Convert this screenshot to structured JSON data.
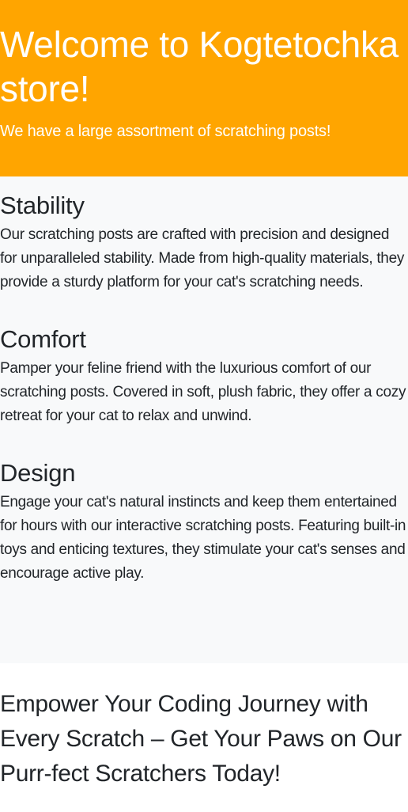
{
  "hero": {
    "title": "Welcome to Kogtetochka store!",
    "subtitle": "We have a large assortment of scratching posts!"
  },
  "features": [
    {
      "title": "Stability",
      "text": "Our scratching posts are crafted with precision and designed for unparalleled stability. Made from high-quality materials, they provide a sturdy platform for your cat's scratching needs."
    },
    {
      "title": "Comfort",
      "text": "Pamper your feline friend with the luxurious comfort of our scratching posts. Covered in soft, plush fabric, they offer a cozy retreat for your cat to relax and unwind."
    },
    {
      "title": "Design",
      "text": "Engage your cat's natural instincts and keep them entertained for hours with our interactive scratching posts. Featuring built-in toys and enticing textures, they stimulate your cat's senses and encourage active play."
    }
  ],
  "cta": {
    "text": "Empower Your Coding Journey with Every Scratch – Get Your Paws on Our Purr-fect Scratchers Today!"
  },
  "colors": {
    "hero_background": "#ffa500",
    "features_background": "#f8f9fa",
    "text": "#212529"
  }
}
